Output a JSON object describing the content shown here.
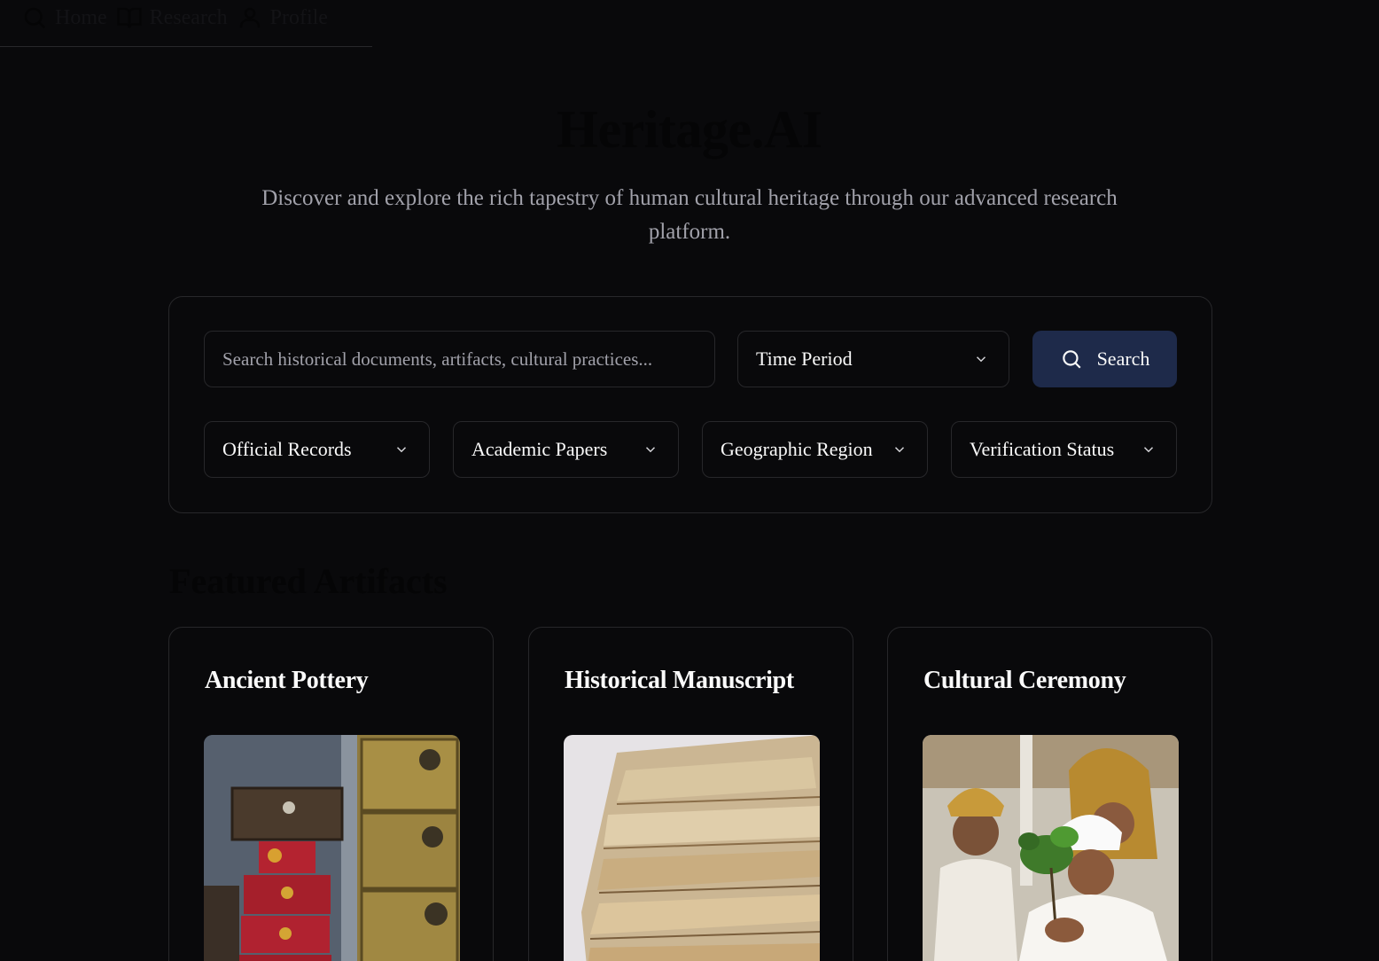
{
  "nav": {
    "items": [
      {
        "label": "Home",
        "icon": "search-icon"
      },
      {
        "label": "Research",
        "icon": "book-open-icon"
      },
      {
        "label": "Profile",
        "icon": "user-icon"
      }
    ]
  },
  "hero": {
    "title": "Heritage.AI",
    "subtitle": "Discover and explore the rich tapestry of human cultural heritage through our advanced research platform."
  },
  "filters": {
    "search_placeholder": "Search historical documents, artifacts, cultural practices...",
    "time_period": "Time Period",
    "search_button": "Search",
    "official_records": "Official Records",
    "academic_papers": "Academic Papers",
    "geographic_region": "Geographic Region",
    "verification_status": "Verification Status"
  },
  "featured": {
    "title": "Featured Artifacts",
    "cards": [
      {
        "title": "Ancient Pottery"
      },
      {
        "title": "Historical Manuscript"
      },
      {
        "title": "Cultural Ceremony"
      }
    ]
  },
  "colors": {
    "background": "#09090b",
    "border": "#27272a",
    "primary_button": "#1e2a4a",
    "muted_text": "#a1a1aa"
  }
}
